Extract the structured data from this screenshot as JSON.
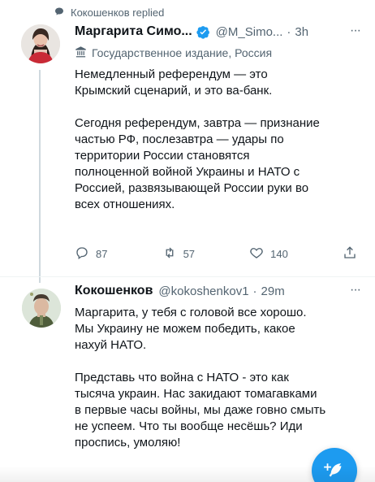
{
  "context_line": {
    "text": "Кокошенков replied",
    "icon": "comment-bubble-icon"
  },
  "tweets": [
    {
      "author": {
        "display_name": "Маргарита Симо...",
        "handle": "@M_Simo...",
        "time": "3h",
        "verified": true,
        "label": "Государственное издание, Россия"
      },
      "text": "Немедленный референдум — это\nКрымский сценарий, и это ва-банк.\n\nСегодня референдум, завтра — признание\nчастью РФ, послезавтра — удары по\nтерритории России становятся\nполноценной войной Украины и НАТО с\nРоссией, развязывающей России руки во\nвсех отношениях.",
      "metrics": {
        "replies": "87",
        "retweets": "57",
        "likes": "140"
      }
    },
    {
      "author": {
        "display_name": "Кокошенков",
        "handle": "@kokoshenkov1",
        "time": "29m"
      },
      "text": "Маргарита, у тебя с головой все хорошо.\nМы Украину не можем победить, какое\nнахуй НАТО.\n\nПредставь что война с НАТО - это как\nтысяча украин. Нас закидают томагавками\nв первые часы войны, мы даже говно смыть\nне успеем. Что ты вообще несёшь? Иди\nпроспись, умоляю!"
    }
  ],
  "dot_separator": "·",
  "more_glyph": "···",
  "fab": {
    "icon": "compose-tweet-icon"
  },
  "colors": {
    "accent": "#1d9bf0",
    "text": "#0f1419",
    "muted": "#536471",
    "divider": "#eff3f4"
  }
}
